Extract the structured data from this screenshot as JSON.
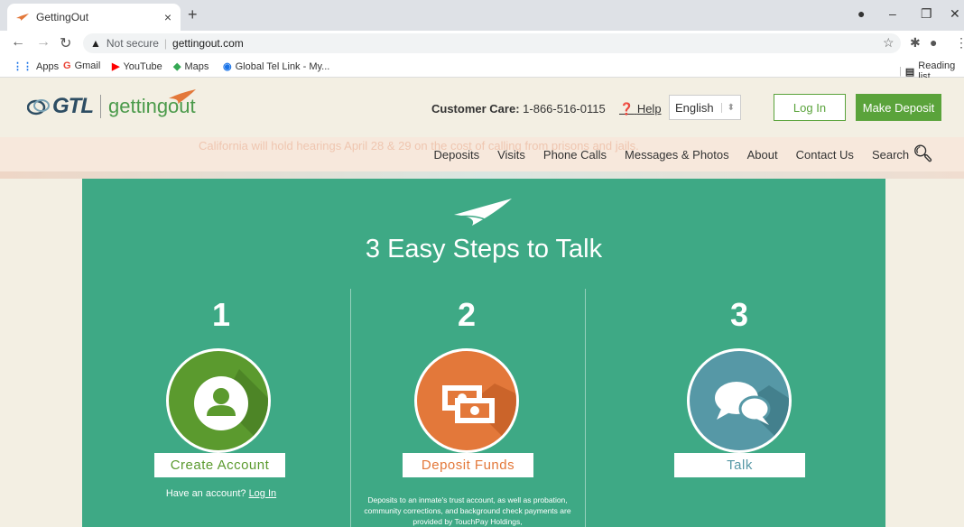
{
  "browser": {
    "tab_title": "GettingOut",
    "url_warning": "Not secure",
    "url": "gettingout.com",
    "bookmarks": [
      "Apps",
      "Gmail",
      "YouTube",
      "Maps",
      "Global Tel Link - My..."
    ],
    "reading_list": "Reading list"
  },
  "header": {
    "logo_gtl": "GTL",
    "logo_getting": "gettingout",
    "customer_care_label": "Customer Care:",
    "customer_care_phone": "1-866-516-0115",
    "help": "Help",
    "language": "English",
    "login": "Log In",
    "make_deposit": "Make Deposit"
  },
  "nav": {
    "banner": "California will hold hearings April 28 & 29 on the cost of calling from prisons and jails.",
    "links": [
      "Deposits",
      "Visits",
      "Phone Calls",
      "Messages & Photos",
      "About",
      "Contact Us",
      "Search"
    ]
  },
  "main": {
    "heading": "3 Easy Steps to Talk",
    "steps": [
      {
        "number": "1",
        "button": "Create Account",
        "icon": "user-icon"
      },
      {
        "number": "2",
        "button": "Deposit Funds",
        "icon": "money-icon"
      },
      {
        "number": "3",
        "button": "Talk",
        "icon": "chat-icon"
      }
    ],
    "have_account": "Have an account?",
    "have_account_link": "Log In",
    "fine_print": "Deposits to an inmate's trust account, as well as probation, community corrections, and background check payments are provided by TouchPay Holdings,"
  },
  "colors": {
    "panel": "#3ea985",
    "green_button": "#5aa33b",
    "step1": "#5b9a2e",
    "step2": "#e3783a",
    "step3": "#5698a6"
  }
}
